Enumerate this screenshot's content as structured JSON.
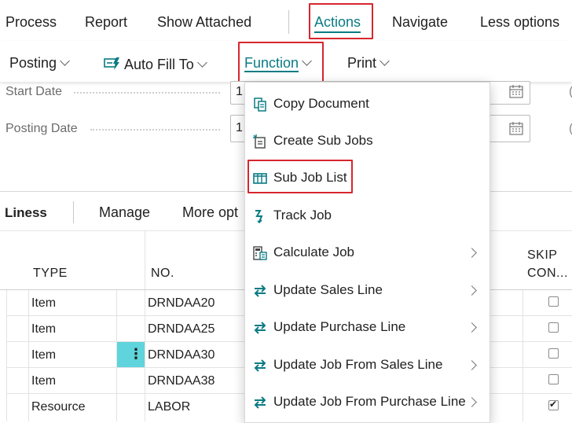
{
  "top_menu": {
    "process": "Process",
    "report": "Report",
    "show_attached": "Show Attached",
    "actions": "Actions",
    "navigate": "Navigate",
    "less_options": "Less options"
  },
  "sub_menu": {
    "posting": "Posting",
    "auto_fill_to": "Auto Fill To",
    "function": "Function",
    "print": "Print"
  },
  "fields": {
    "start_date_label": "Start Date",
    "start_date_value": "1",
    "posting_date_label": "Posting Date",
    "posting_date_value": "1"
  },
  "lines_toolbar": {
    "title": "Liness",
    "manage": "Manage",
    "more_options": "More opt"
  },
  "table": {
    "headers": {
      "type": "TYPE",
      "no": "NO.",
      "skip_1": "SKIP",
      "skip_2": "CON..."
    },
    "rows": [
      {
        "type": "Item",
        "no": "DRNDAA20",
        "checked": false
      },
      {
        "type": "Item",
        "no": "DRNDAA25",
        "checked": false
      },
      {
        "type": "Item",
        "no": "DRNDAA30",
        "checked": false
      },
      {
        "type": "Item",
        "no": "DRNDAA38",
        "checked": false
      },
      {
        "type": "Resource",
        "no": "LABOR",
        "checked": true
      }
    ]
  },
  "function_menu": {
    "items": [
      {
        "label": "Copy Document",
        "icon": "copy-document-icon"
      },
      {
        "label": "Create Sub Jobs",
        "icon": "create-sub-jobs-icon"
      },
      {
        "label": "Sub Job List",
        "icon": "list-icon"
      },
      {
        "label": "Track Job",
        "icon": "track-job-icon"
      },
      {
        "label": "Calculate Job",
        "icon": "calculate-icon"
      },
      {
        "label": "Update Sales Line",
        "icon": "update-arrows-icon"
      },
      {
        "label": "Update Purchase Line",
        "icon": "update-arrows-icon"
      },
      {
        "label": "Update Job From Sales Line",
        "icon": "update-arrows-icon"
      },
      {
        "label": "Update Job From Purchase Line",
        "icon": "update-arrows-icon"
      }
    ]
  },
  "colors": {
    "accent": "#0a7b83",
    "highlight_box": "#d7262e",
    "row_action": "#5fd4dc"
  }
}
